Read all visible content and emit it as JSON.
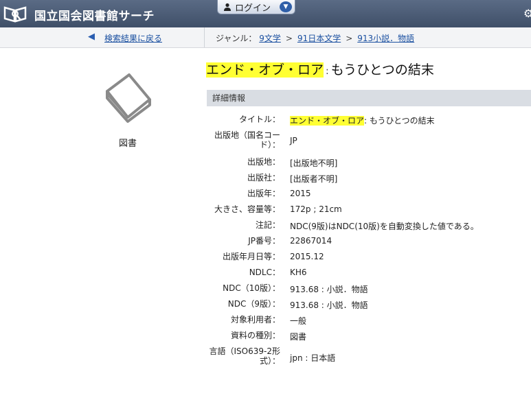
{
  "header": {
    "site_title": "国立国会図書館サーチ",
    "login_label": "ログイン"
  },
  "nav": {
    "back_label": "検索結果に戻る",
    "genre_prefix": "ジャンル：",
    "genres": [
      "9文学",
      "91日本文学",
      "913小説．物語"
    ]
  },
  "left": {
    "material_type": "図書"
  },
  "title": {
    "main_highlight": "エンド・オブ・ロア",
    "separator": ":",
    "subtitle": "もうひとつの結末"
  },
  "section": {
    "heading": "詳細情報"
  },
  "details": [
    {
      "label": "タイトル：",
      "value_highlight": "エンド・オブ・ロア",
      "value_rest": ": もうひとつの結末"
    },
    {
      "label": "出版地（国名コード）：",
      "value": "JP"
    },
    {
      "label": "出版地：",
      "value": "[出版地不明]"
    },
    {
      "label": "出版社：",
      "value": "[出版者不明]"
    },
    {
      "label": "出版年：",
      "value": "2015"
    },
    {
      "label": "大きさ、容量等：",
      "value": "172p ; 21cm"
    },
    {
      "label": "注記：",
      "value": "NDC(9版)はNDC(10版)を自動変換した値である。"
    },
    {
      "label": "JP番号：",
      "value": "22867014"
    },
    {
      "label": "出版年月日等：",
      "value": "2015.12"
    },
    {
      "label": "NDLC：",
      "value": "KH6"
    },
    {
      "label": "NDC（10版）：",
      "value": "913.68 : 小説．物語"
    },
    {
      "label": "NDC（9版）：",
      "value": "913.68 : 小説．物語"
    },
    {
      "label": "対象利用者：",
      "value": "一般"
    },
    {
      "label": "資料の種別：",
      "value": "図書"
    },
    {
      "label": "言語（ISO639-2形式）：",
      "value": "jpn : 日本語"
    }
  ],
  "colors": {
    "header_bg": "#4a5a74",
    "highlight": "#ffff33",
    "link": "#1a4fa0",
    "section_bg": "#d9dde3"
  }
}
